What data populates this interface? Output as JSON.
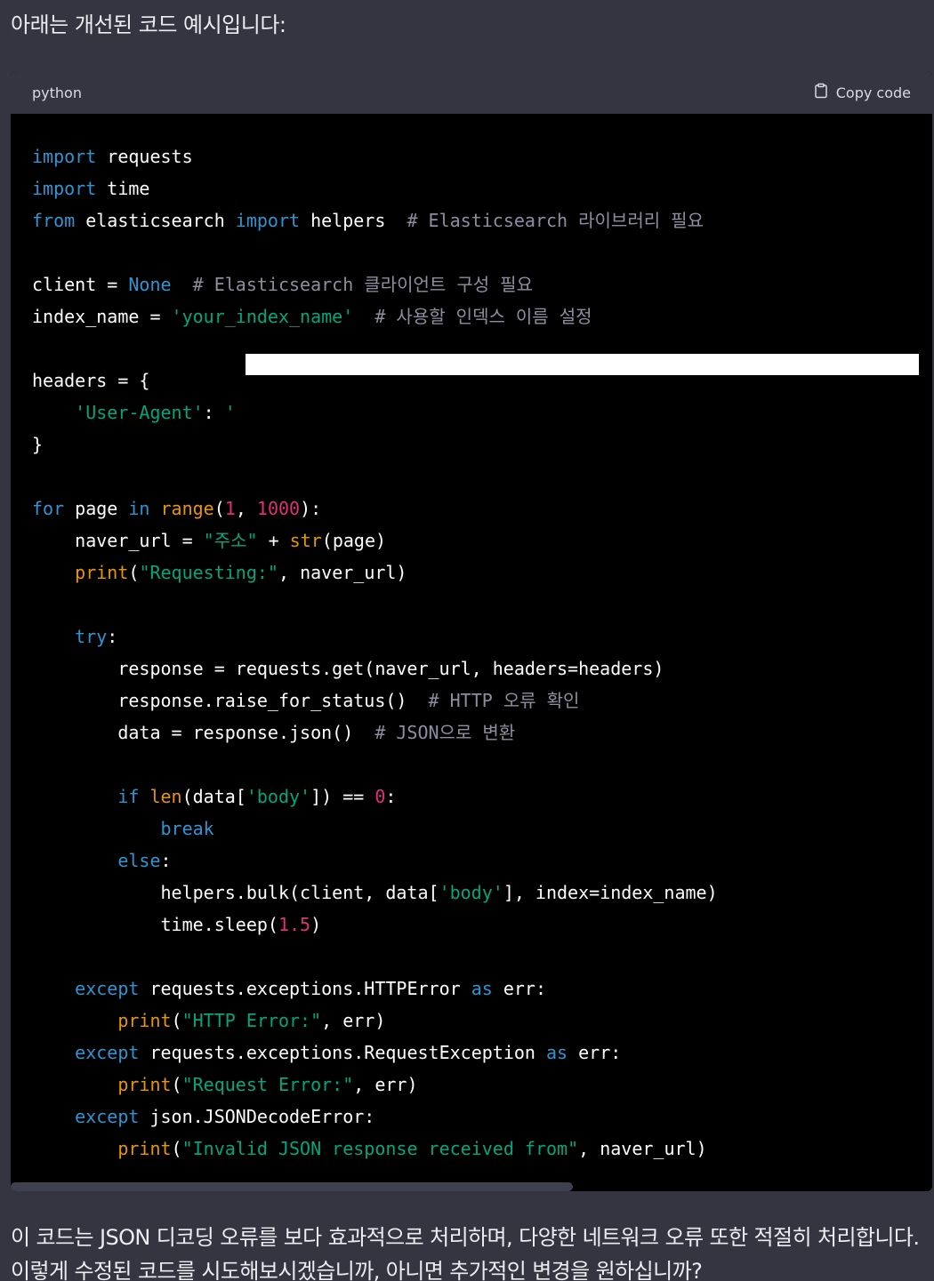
{
  "intro_text": "아래는 개선된 코드 예시입니다:",
  "code_block": {
    "language": "python",
    "copy_label": "Copy code",
    "lines": [
      [
        {
          "t": "import",
          "c": "kw"
        },
        {
          "t": " requests"
        }
      ],
      [
        {
          "t": "import",
          "c": "kw"
        },
        {
          "t": " time"
        }
      ],
      [
        {
          "t": "from",
          "c": "kw"
        },
        {
          "t": " elasticsearch "
        },
        {
          "t": "import",
          "c": "kw"
        },
        {
          "t": " helpers  "
        },
        {
          "t": "# Elasticsearch 라이브러리 필요",
          "c": "cm"
        }
      ],
      [],
      [
        {
          "t": "client = "
        },
        {
          "t": "None",
          "c": "kw"
        },
        {
          "t": "  "
        },
        {
          "t": "# Elasticsearch 클라이언트 구성 필요",
          "c": "cm"
        }
      ],
      [
        {
          "t": "index_name = "
        },
        {
          "t": "'your_index_name'",
          "c": "str"
        },
        {
          "t": "  "
        },
        {
          "t": "# 사용할 인덱스 이름 설정",
          "c": "cm"
        }
      ],
      [],
      [
        {
          "t": "headers = {"
        }
      ],
      [
        {
          "t": "    "
        },
        {
          "t": "'User-Agent'",
          "c": "str"
        },
        {
          "t": ": "
        },
        {
          "t": "'",
          "c": "str"
        }
      ],
      [
        {
          "t": "}"
        }
      ],
      [],
      [
        {
          "t": "for",
          "c": "kw"
        },
        {
          "t": " page "
        },
        {
          "t": "in",
          "c": "kw"
        },
        {
          "t": " "
        },
        {
          "t": "range",
          "c": "fn"
        },
        {
          "t": "("
        },
        {
          "t": "1",
          "c": "num"
        },
        {
          "t": ", "
        },
        {
          "t": "1000",
          "c": "num"
        },
        {
          "t": "):"
        }
      ],
      [
        {
          "t": "    naver_url = "
        },
        {
          "t": "\"주소\"",
          "c": "str"
        },
        {
          "t": " + "
        },
        {
          "t": "str",
          "c": "fn"
        },
        {
          "t": "(page)"
        }
      ],
      [
        {
          "t": "    "
        },
        {
          "t": "print",
          "c": "fn"
        },
        {
          "t": "("
        },
        {
          "t": "\"Requesting:\"",
          "c": "str"
        },
        {
          "t": ", naver_url)"
        }
      ],
      [],
      [
        {
          "t": "    "
        },
        {
          "t": "try",
          "c": "kw"
        },
        {
          "t": ":"
        }
      ],
      [
        {
          "t": "        response = requests.get(naver_url, headers=headers)"
        }
      ],
      [
        {
          "t": "        response.raise_for_status()  "
        },
        {
          "t": "# HTTP 오류 확인",
          "c": "cm"
        }
      ],
      [
        {
          "t": "        data = response.json()  "
        },
        {
          "t": "# JSON으로 변환",
          "c": "cm"
        }
      ],
      [],
      [
        {
          "t": "        "
        },
        {
          "t": "if",
          "c": "kw"
        },
        {
          "t": " "
        },
        {
          "t": "len",
          "c": "fn"
        },
        {
          "t": "(data["
        },
        {
          "t": "'body'",
          "c": "str"
        },
        {
          "t": "]) == "
        },
        {
          "t": "0",
          "c": "num"
        },
        {
          "t": ":"
        }
      ],
      [
        {
          "t": "            "
        },
        {
          "t": "break",
          "c": "kw"
        }
      ],
      [
        {
          "t": "        "
        },
        {
          "t": "else",
          "c": "kw"
        },
        {
          "t": ":"
        }
      ],
      [
        {
          "t": "            helpers.bulk(client, data["
        },
        {
          "t": "'body'",
          "c": "str"
        },
        {
          "t": "], index=index_name)"
        }
      ],
      [
        {
          "t": "            time.sleep("
        },
        {
          "t": "1.5",
          "c": "num"
        },
        {
          "t": ")"
        }
      ],
      [],
      [
        {
          "t": "    "
        },
        {
          "t": "except",
          "c": "kw"
        },
        {
          "t": " requests.exceptions.HTTPError "
        },
        {
          "t": "as",
          "c": "kw"
        },
        {
          "t": " err:"
        }
      ],
      [
        {
          "t": "        "
        },
        {
          "t": "print",
          "c": "fn"
        },
        {
          "t": "("
        },
        {
          "t": "\"HTTP Error:\"",
          "c": "str"
        },
        {
          "t": ", err)"
        }
      ],
      [
        {
          "t": "    "
        },
        {
          "t": "except",
          "c": "kw"
        },
        {
          "t": " requests.exceptions.RequestException "
        },
        {
          "t": "as",
          "c": "kw"
        },
        {
          "t": " err:"
        }
      ],
      [
        {
          "t": "        "
        },
        {
          "t": "print",
          "c": "fn"
        },
        {
          "t": "("
        },
        {
          "t": "\"Request Error:\"",
          "c": "str"
        },
        {
          "t": ", err)"
        }
      ],
      [
        {
          "t": "    "
        },
        {
          "t": "except",
          "c": "kw"
        },
        {
          "t": " json.JSONDecodeError:"
        }
      ],
      [
        {
          "t": "        "
        },
        {
          "t": "print",
          "c": "fn"
        },
        {
          "t": "("
        },
        {
          "t": "\"Invalid JSON response received from\"",
          "c": "str"
        },
        {
          "t": ", naver_url)"
        }
      ]
    ]
  },
  "outro_text": "이 코드는 JSON 디코딩 오류를 보다 효과적으로 처리하며, 다양한 네트워크 오류 또한 적절히 처리합니다. 이렇게 수정된 코드를 시도해보시겠습니까, 아니면 추가적인 변경을 원하십니까?",
  "colors": {
    "background": "#343541",
    "code_background": "#000000",
    "keyword": "#2e95d3",
    "string": "#00a67d",
    "number": "#df3079",
    "builtin": "#e9950c",
    "comment": "#8e8ea0"
  }
}
